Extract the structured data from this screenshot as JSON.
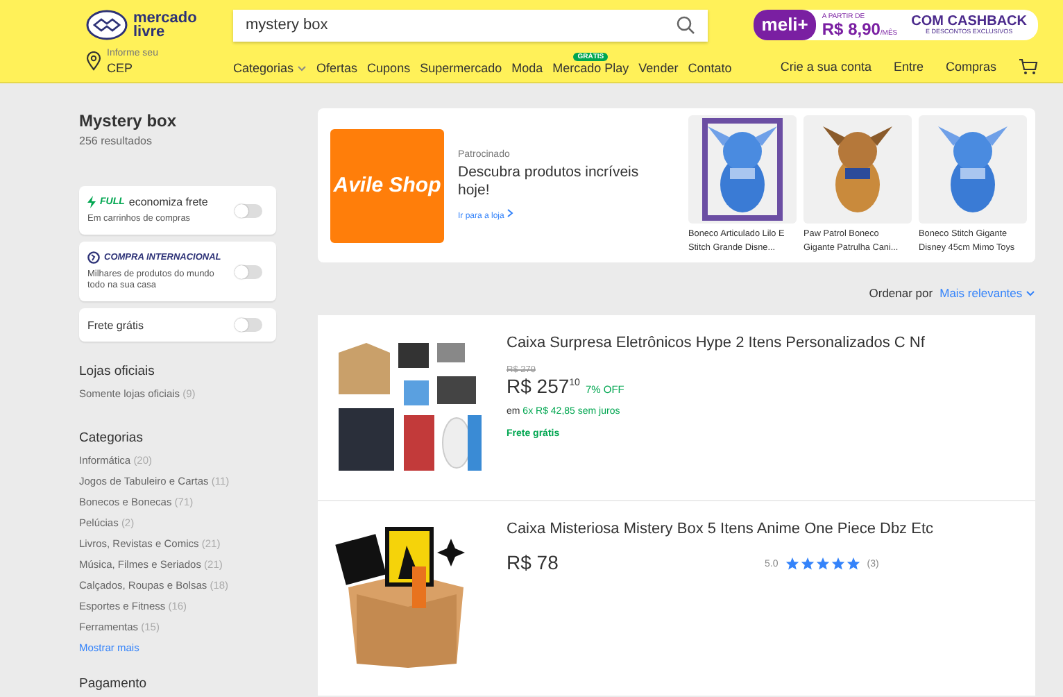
{
  "header": {
    "logo": [
      "mercado",
      "livre"
    ],
    "search": {
      "value": "mystery box"
    },
    "promo": {
      "brand": "meli+",
      "from": "A PARTIR DE",
      "price": "R$ 8,90",
      "per": "/MÊS",
      "headline": "COM CASHBACK",
      "sub": "E DESCONTOS EXCLUSIVOS"
    },
    "location": {
      "hint": "Informe seu",
      "value": "CEP"
    },
    "nav": [
      {
        "label": "Categorias",
        "kind": "dropdown"
      },
      {
        "label": "Ofertas",
        "kind": "link"
      },
      {
        "label": "Cupons",
        "kind": "link"
      },
      {
        "label": "Supermercado",
        "kind": "link"
      },
      {
        "label": "Moda",
        "kind": "link"
      },
      {
        "label": "Mercado Play",
        "kind": "badge",
        "badge": "GRÁTIS"
      },
      {
        "label": "Vender",
        "kind": "link"
      },
      {
        "label": "Contato",
        "kind": "link"
      }
    ],
    "account": [
      "Crie a sua conta",
      "Entre",
      "Compras"
    ]
  },
  "sidebar": {
    "title": "Mystery box",
    "count": "256 resultados",
    "filters": [
      {
        "kind": "full",
        "brand": "FULL",
        "label": "economiza frete",
        "sub": "Em carrinhos de compras",
        "on": false
      },
      {
        "kind": "intl",
        "brand": "COMPRA INTERNACIONAL",
        "sub": "Milhares de produtos do mundo todo na sua casa",
        "on": false
      },
      {
        "kind": "plain",
        "label": "Frete grátis",
        "on": false
      }
    ],
    "groups": [
      {
        "title": "Lojas oficiais",
        "items": [
          {
            "label": "Somente lojas oficiais",
            "count": "(9)"
          }
        ]
      },
      {
        "title": "Categorias",
        "items": [
          {
            "label": "Informática",
            "count": "(20)"
          },
          {
            "label": "Jogos de Tabuleiro e Cartas",
            "count": "(11)"
          },
          {
            "label": "Bonecos e Bonecas",
            "count": "(71)"
          },
          {
            "label": "Pelúcias",
            "count": "(2)"
          },
          {
            "label": "Livros, Revistas e Comics",
            "count": "(21)"
          },
          {
            "label": "Música, Filmes e Seriados",
            "count": "(21)"
          },
          {
            "label": "Calçados, Roupas e Bolsas",
            "count": "(18)"
          },
          {
            "label": "Esportes e Fitness",
            "count": "(16)"
          },
          {
            "label": "Ferramentas",
            "count": "(15)"
          }
        ],
        "more": "Mostrar mais"
      },
      {
        "title": "Pagamento"
      }
    ]
  },
  "ad": {
    "logo": "Avile Shop",
    "tag": "Patrocinado",
    "headline": "Descubra produtos incríveis hoje!",
    "link": "Ir para a loja",
    "products": [
      {
        "title": "Boneco Articulado Lilo E Stitch Grande Disne..."
      },
      {
        "title": "Paw Patrol Boneco Gigante Patrulha Cani..."
      },
      {
        "title": "Boneco Stitch Gigante Disney 45cm Mimo Toys"
      }
    ]
  },
  "sort": {
    "label": "Ordenar por",
    "value": "Mais relevantes"
  },
  "results": [
    {
      "title": "Caixa Surpresa Eletrônicos Hype 2 Itens Personalizados C Nf",
      "old_price": "R$ 279",
      "price": "R$ 257",
      "cents": "10",
      "discount": "7% OFF",
      "installments_prefix": "em",
      "installments": "6x R$ 42,85 sem juros",
      "shipping": "Frete grátis"
    },
    {
      "title": "Caixa Misteriosa Mistery Box 5 Itens Anime One Piece Dbz Etc",
      "price": "R$ 78",
      "rating": "5.0",
      "stars": 5,
      "reviews": "(3)"
    }
  ]
}
